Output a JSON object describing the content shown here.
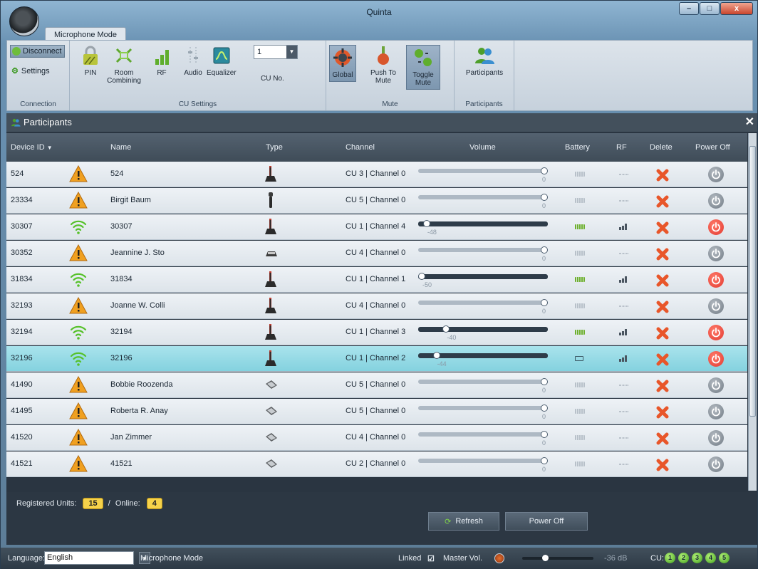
{
  "window": {
    "title": "Quinta"
  },
  "ribbon": {
    "tab": "Microphone Mode",
    "connection": {
      "disconnect": "Disconnect",
      "settings": "Settings",
      "label": "Connection"
    },
    "cu_settings": {
      "pin": "PIN",
      "room": "Room\nCombining",
      "rf": "RF",
      "audio": "Audio",
      "equalizer": "Equalizer",
      "cu_no": "CU No.",
      "cu_value": "1",
      "label": "CU Settings"
    },
    "mute": {
      "global": "Global",
      "push": "Push To\nMute",
      "toggle": "Toggle\nMute",
      "label": "Mute"
    },
    "participants": {
      "button": "Participants",
      "label": "Participants"
    }
  },
  "panel": {
    "title": "Participants"
  },
  "columns": {
    "device": "Device ID",
    "name": "Name",
    "type": "Type",
    "channel": "Channel",
    "volume": "Volume",
    "battery": "Battery",
    "rf": "RF",
    "delete": "Delete",
    "power": "Power Off"
  },
  "rows": [
    {
      "id": "524",
      "name": "524",
      "status": "warning",
      "type": "desk",
      "channel": "CU 3 | Channel 0",
      "volume": "0",
      "vol_level": 1.0,
      "active": false
    },
    {
      "id": "23334",
      "name": "Birgit Baum",
      "status": "warning",
      "type": "handheld",
      "channel": "CU 5 | Channel 0",
      "volume": "0",
      "vol_level": 1.0,
      "active": false
    },
    {
      "id": "30307",
      "name": "30307",
      "status": "wifi",
      "type": "desk",
      "channel": "CU 1 | Channel 4",
      "volume": "-48",
      "vol_level": 0.04,
      "active": true
    },
    {
      "id": "30352",
      "name": "Jeannine J. Sto",
      "status": "warning",
      "type": "boundary",
      "channel": "CU 4 | Channel 0",
      "volume": "0",
      "vol_level": 1.0,
      "active": false
    },
    {
      "id": "31834",
      "name": "31834",
      "status": "wifi",
      "type": "desk",
      "channel": "CU 1 | Channel 1",
      "volume": "-50",
      "vol_level": 0.0,
      "active": true
    },
    {
      "id": "32193",
      "name": "Joanne W. Colli",
      "status": "warning",
      "type": "desk",
      "channel": "CU 4 | Channel 0",
      "volume": "0",
      "vol_level": 1.0,
      "active": false
    },
    {
      "id": "32194",
      "name": "32194",
      "status": "wifi",
      "type": "desk",
      "channel": "CU 1 | Channel 3",
      "volume": "-40",
      "vol_level": 0.2,
      "active": true
    },
    {
      "id": "32196",
      "name": "32196",
      "status": "wifi",
      "type": "desk",
      "channel": "CU 1 | Channel 2",
      "volume": "-44",
      "vol_level": 0.12,
      "active": true,
      "selected": true
    },
    {
      "id": "41490",
      "name": "Bobbie Roozenda",
      "status": "warning",
      "type": "bodypack",
      "channel": "CU 5 | Channel 0",
      "volume": "0",
      "vol_level": 1.0,
      "active": false
    },
    {
      "id": "41495",
      "name": "Roberta R. Anay",
      "status": "warning",
      "type": "bodypack",
      "channel": "CU 5 | Channel 0",
      "volume": "0",
      "vol_level": 1.0,
      "active": false
    },
    {
      "id": "41520",
      "name": "Jan Zimmer",
      "status": "warning",
      "type": "bodypack",
      "channel": "CU 4 | Channel 0",
      "volume": "0",
      "vol_level": 1.0,
      "active": false
    },
    {
      "id": "41521",
      "name": "41521",
      "status": "warning",
      "type": "bodypack",
      "channel": "CU 2 | Channel 0",
      "volume": "0",
      "vol_level": 1.0,
      "active": false
    }
  ],
  "footer": {
    "registered_label": "Registered Units:",
    "registered": "15",
    "sep": "/",
    "online_label": "Online:",
    "online": "4",
    "refresh": "Refresh",
    "power_off": "Power Off"
  },
  "statusbar": {
    "language_label": "Language:",
    "language": "English",
    "mode": "Microphone Mode",
    "linked": "Linked",
    "master": "Master Vol.",
    "db": "-36 dB",
    "master_level": 0.3,
    "cu_label": "CU:",
    "cus": [
      "1",
      "2",
      "3",
      "4",
      "5"
    ]
  },
  "colors": {
    "warning": "#f0a020",
    "wifi": "#56c12a",
    "delete": "#e8562a",
    "power_on": "#e33a30",
    "power_off": "#707a84"
  }
}
